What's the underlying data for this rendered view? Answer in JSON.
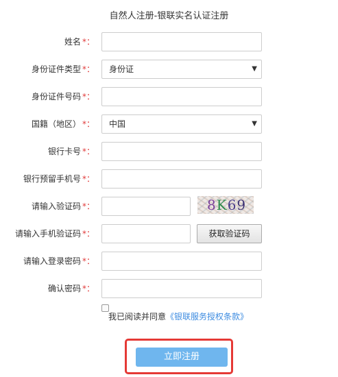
{
  "title": "自然人注册-银联实名认证注册",
  "required_mark": "*：",
  "fields": {
    "name": {
      "label": "姓名",
      "value": ""
    },
    "id_type": {
      "label": "身份证件类型",
      "value": "身份证"
    },
    "id_number": {
      "label": "身份证件号码",
      "value": ""
    },
    "nationality": {
      "label": "国籍（地区）",
      "value": "中国"
    },
    "bank_card": {
      "label": "银行卡号",
      "value": ""
    },
    "bank_phone": {
      "label": "银行预留手机号",
      "value": ""
    },
    "captcha": {
      "label": "请输入验证码",
      "value": "",
      "image_text": [
        "8",
        "K",
        "6",
        "9"
      ]
    },
    "sms_code": {
      "label": "请输入手机验证码",
      "value": "",
      "button": "获取验证码"
    },
    "password": {
      "label": "请输入登录密码",
      "value": ""
    },
    "confirm_password": {
      "label": "确认密码",
      "value": ""
    }
  },
  "agreement": {
    "text": "我已阅读并同意",
    "link": "《银联服务授权条款》",
    "checked": false
  },
  "submit_label": "立即注册",
  "colors": {
    "required": "#e03a3a",
    "link": "#3c8be0",
    "submit": "#6fb6ee",
    "highlight": "#e53935"
  },
  "icons": {
    "dropdown": "triangle-down-icon"
  }
}
